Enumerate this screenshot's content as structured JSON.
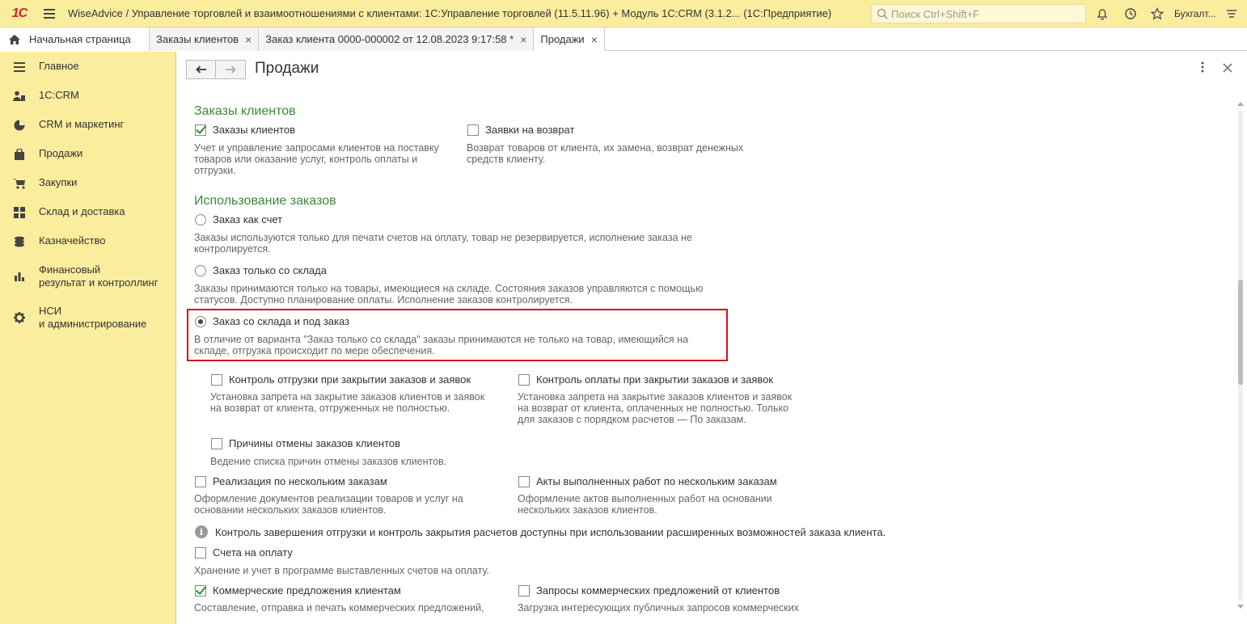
{
  "window": {
    "logo": "1С",
    "title": "WiseAdvice / Управление торговлей и взаимоотношениями с клиентами: 1С:Управление торговлей (11.5.11.96) + Модуль 1С:CRM (3.1.2...   (1С:Предприятие)",
    "search_placeholder": "Поиск Ctrl+Shift+F",
    "user": "Бухгалт..."
  },
  "tabs": [
    {
      "label": "Начальная страница"
    },
    {
      "label": "Заказы клиентов",
      "close": "×"
    },
    {
      "label": "Заказ клиента 0000-000002 от 12.08.2023 9:17:58 *",
      "close": "×"
    },
    {
      "label": "Продажи",
      "close": "×"
    }
  ],
  "sidebar": {
    "items": [
      {
        "label": "Главное",
        "icon": "menu-icon"
      },
      {
        "label": "1С:CRM",
        "icon": "users-icon"
      },
      {
        "label": "CRM и маркетинг",
        "icon": "pie-chart-icon"
      },
      {
        "label": "Продажи",
        "icon": "bag-icon"
      },
      {
        "label": "Закупки",
        "icon": "cart-icon"
      },
      {
        "label": "Склад и доставка",
        "icon": "grid-icon"
      },
      {
        "label": "Казначейство",
        "icon": "coins-icon"
      },
      {
        "label": "Финансовый\nрезультат и контроллинг",
        "icon": "bar-chart-icon"
      },
      {
        "label": "НСИ\nи администрирование",
        "icon": "gear-icon"
      }
    ]
  },
  "page": {
    "title": "Продажи",
    "sections": {
      "orders": "Заказы клиентов",
      "usage": "Использование заказов"
    },
    "options": {
      "client_orders": {
        "label": "Заказы клиентов",
        "checked": true,
        "desc": "Учет и управление запросами клиентов на поставку\nтоваров или оказание услуг, контроль оплаты и\nотгрузки."
      },
      "return_requests": {
        "label": "Заявки на возврат",
        "checked": false,
        "desc": "Возврат товаров от клиента, их замена, возврат денежных\nсредств клиенту."
      },
      "order_as_invoice": {
        "label": "Заказ как счет",
        "selected": false,
        "desc": "Заказы используются только для печати счетов на оплату, товар не резервируется, исполнение заказа не\nконтролируется."
      },
      "order_from_stock": {
        "label": "Заказ только со склада",
        "selected": false,
        "desc": "Заказы принимаются только на товары, имеющиеся на складе. Состояния заказов управляются с помощью\nстатусов. Доступно планирование оплаты. Исполнение заказов контролируется."
      },
      "order_stock_and_custom": {
        "label": "Заказ со склада и под заказ",
        "selected": true,
        "desc": "В отличие от варианта \"Заказ только со склада\" заказы принимаются не только на товар, имеющийся на\nскладе, отгрузка происходит по мере обеспечения."
      },
      "shipment_control": {
        "label": "Контроль отгрузки при закрытии заказов и заявок",
        "checked": false,
        "desc": "Установка запрета на закрытие заказов клиентов и заявок\nна возврат от клиента, отгруженных не полностью."
      },
      "payment_control": {
        "label": "Контроль оплаты при закрытии заказов и заявок",
        "checked": false,
        "desc": "Установка запрета на закрытие заказов клиентов и заявок\nна возврат от клиента, оплаченных не полностью. Только\nдля заказов с порядком расчетов — По заказам."
      },
      "cancel_reasons": {
        "label": "Причины отмены заказов клиентов",
        "checked": false,
        "desc": "Ведение списка причин отмены заказов клиентов."
      },
      "sales_multi": {
        "label": "Реализация по нескольким заказам",
        "checked": false,
        "desc": "Оформление документов реализации товаров и услуг на\nосновании нескольких заказов клиентов."
      },
      "acts_multi": {
        "label": "Акты выполненных работ по нескольким заказам",
        "checked": false,
        "desc": "Оформление актов выполненных работ на основании\nнескольких заказов клиентов."
      },
      "invoices": {
        "label": "Счета на оплату",
        "checked": false,
        "desc": "Хранение и учет в программе выставленных счетов на оплату."
      },
      "commercial_offers": {
        "label": "Коммерческие предложения клиентам",
        "checked": true,
        "desc": "Составление, отправка и печать коммерческих предложений,"
      },
      "offer_requests": {
        "label": "Запросы коммерческих предложений от клиентов",
        "checked": false,
        "desc": "Загрузка интересующих публичных запросов коммерческих"
      }
    },
    "info_text": "Контроль завершения отгрузки и контроль закрытия расчетов доступны при использовании расширенных возможностей заказа клиента.",
    "info_icon_glyph": "i"
  },
  "colors": {
    "accent_yellow": "#fbed9e",
    "section_green": "#3a8a3a",
    "highlight_red": "#d0121b"
  }
}
